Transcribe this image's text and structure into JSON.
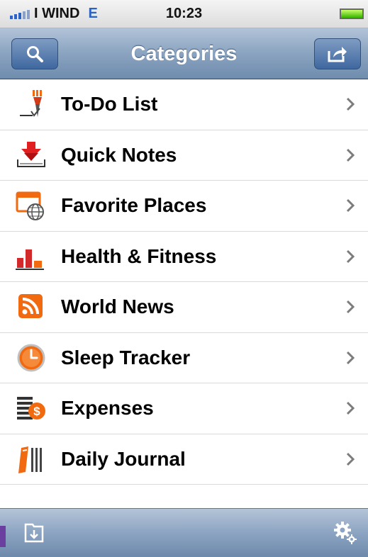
{
  "status_bar": {
    "carrier": "I WIND",
    "network": "E",
    "time": "10:23",
    "battery_level": 1.0
  },
  "navbar": {
    "title": "Categories",
    "left_icon": "search-icon",
    "right_icon": "share-icon"
  },
  "categories": [
    {
      "label": "To-Do List",
      "icon": "todo-list-icon"
    },
    {
      "label": "Quick Notes",
      "icon": "quick-notes-icon"
    },
    {
      "label": "Favorite Places",
      "icon": "favorite-places-icon"
    },
    {
      "label": "Health & Fitness",
      "icon": "health-fitness-icon"
    },
    {
      "label": "World News",
      "icon": "rss-icon"
    },
    {
      "label": "Sleep Tracker",
      "icon": "clock-icon"
    },
    {
      "label": "Expenses",
      "icon": "expenses-icon"
    },
    {
      "label": "Daily Journal",
      "icon": "journal-icon"
    }
  ],
  "toolbar": {
    "left_icon": "import-folder-icon",
    "right_icon": "settings-gears-icon"
  },
  "colors": {
    "accent_orange": "#f26a10",
    "red": "#d22a2a",
    "nav_blue": "#6f8cae",
    "network_blue": "#2b62c4"
  }
}
